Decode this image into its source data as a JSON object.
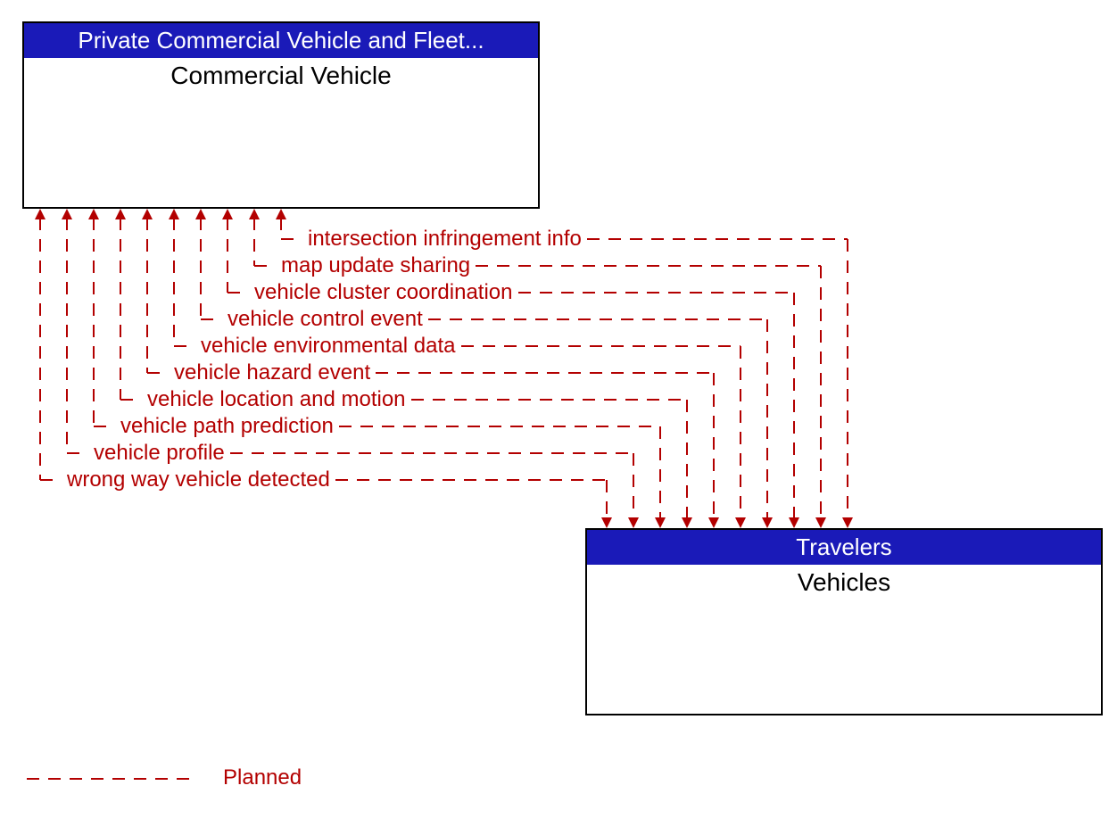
{
  "boxes": {
    "top": {
      "header": "Private Commercial Vehicle and Fleet...",
      "title": "Commercial Vehicle"
    },
    "bottom": {
      "header": "Travelers",
      "title": "Vehicles"
    }
  },
  "flows": [
    "intersection infringement info",
    "map update sharing",
    "vehicle cluster coordination",
    "vehicle control event",
    "vehicle environmental data",
    "vehicle hazard event",
    "vehicle location and motion",
    "vehicle path prediction",
    "vehicle profile",
    "wrong way vehicle detected"
  ],
  "legend": {
    "planned": "Planned"
  },
  "colors": {
    "header_bg": "#1a1ab8",
    "flow": "#b30000",
    "border": "#000000"
  }
}
